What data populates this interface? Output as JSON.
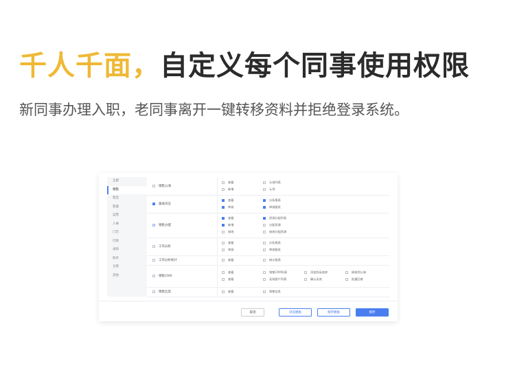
{
  "headline": {
    "accent": "千人千面，",
    "rest": "自定义每个同事使用权限"
  },
  "subline": "新同事办理入职，老同事离开一键转移资料并拒绝登录系统。",
  "sidebar": {
    "items": [
      {
        "label": "全部"
      },
      {
        "label": "销售"
      },
      {
        "label": "售后"
      },
      {
        "label": "客服"
      },
      {
        "label": "运营"
      },
      {
        "label": "人事"
      },
      {
        "label": "门店"
      },
      {
        "label": "行政"
      },
      {
        "label": "采购"
      },
      {
        "label": "财务"
      },
      {
        "label": "仓管"
      },
      {
        "label": "其他"
      }
    ],
    "active_index": 1
  },
  "rows": [
    {
      "name": "销售公海",
      "state": "off",
      "perms": [
        {
          "label": "查看",
          "state": "off"
        },
        {
          "label": "公海列表",
          "state": "off"
        },
        {
          "label": "新增",
          "state": "off"
        },
        {
          "label": "认领",
          "state": "off"
        }
      ]
    },
    {
      "name": "跟进日志",
      "state": "on",
      "perms": [
        {
          "label": "查看",
          "state": "on"
        },
        {
          "label": "分析报表",
          "state": "on"
        },
        {
          "label": "审核",
          "state": "on"
        },
        {
          "label": "审核跟进",
          "state": "on"
        }
      ]
    },
    {
      "name": "销售分配",
      "state": "half",
      "perms": [
        {
          "label": "查看",
          "state": "on"
        },
        {
          "label": "资源分配列表",
          "state": "on"
        },
        {
          "label": "新增",
          "state": "on"
        },
        {
          "label": "分配资源",
          "state": "off"
        },
        {
          "label": "修改",
          "state": "off"
        },
        {
          "label": "修改分配资源",
          "state": "off"
        }
      ]
    },
    {
      "name": "工作分析",
      "state": "off",
      "perms": [
        {
          "label": "查看",
          "state": "off"
        },
        {
          "label": "分析报表",
          "state": "off"
        },
        {
          "label": "审核",
          "state": "off"
        },
        {
          "label": "审核跟进",
          "state": "off"
        }
      ]
    },
    {
      "name": "工作分析统计",
      "state": "off",
      "perms": [
        {
          "label": "查看",
          "state": "off"
        },
        {
          "label": "统计报表",
          "state": "off"
        }
      ]
    },
    {
      "name": "销售CRM",
      "state": "off",
      "perms": [
        {
          "label": "查看",
          "state": "off"
        },
        {
          "label": "销售CRM列表",
          "state": "off"
        },
        {
          "label": "添加到无效库",
          "state": "off"
        },
        {
          "label": "释放到公海",
          "state": "off"
        },
        {
          "label": "查看",
          "state": "off"
        },
        {
          "label": "无效客户列表",
          "state": "off"
        },
        {
          "label": "确认无效",
          "state": "off"
        },
        {
          "label": "批量回收",
          "state": "off"
        }
      ]
    },
    {
      "name": "销售信息",
      "state": "off",
      "perms": [
        {
          "label": "查看",
          "state": "off"
        },
        {
          "label": "销售信息",
          "state": "off"
        }
      ]
    }
  ],
  "footer": {
    "cancel": "取消",
    "preview": "浏览模板",
    "save_template": "保存模板",
    "save": "保存"
  },
  "colors": {
    "accent": "#efb936",
    "primary": "#4a7ef0",
    "text": "#2b2b2b"
  }
}
